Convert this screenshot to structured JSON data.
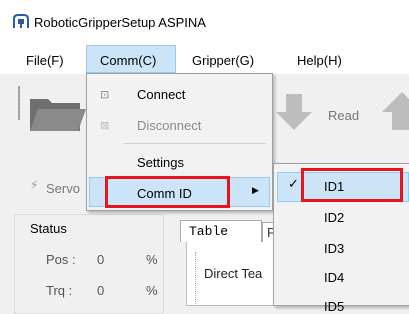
{
  "window": {
    "title": "RoboticGripperSetup ASPINA"
  },
  "menubar": {
    "items": [
      {
        "label": "File(F)"
      },
      {
        "label": "Comm(C)"
      },
      {
        "label": "Gripper(G)"
      },
      {
        "label": "Help(H)"
      }
    ]
  },
  "toolbar": {
    "read_label": "Read"
  },
  "servo": {
    "label": "Servo"
  },
  "status": {
    "title": "Status",
    "pos_label": "Pos :",
    "pos_value": "0",
    "pos_unit": "%",
    "trq_label": "Trq :",
    "trq_value": "0",
    "trq_unit": "%"
  },
  "tabs": {
    "active_label": "Table",
    "second_label": "P"
  },
  "panel": {
    "direct_teach_label": "Direct Tea"
  },
  "comm_menu": {
    "items": [
      {
        "label": "Connect",
        "icon": "connect-icon",
        "enabled": true
      },
      {
        "label": "Disconnect",
        "icon": "disconnect-icon",
        "enabled": false
      },
      {
        "label": "Settings",
        "enabled": true
      },
      {
        "label": "Comm ID",
        "enabled": true,
        "has_submenu": true
      }
    ]
  },
  "comm_id_submenu": {
    "checkmark": "✓",
    "items": [
      {
        "label": "ID1",
        "checked": true
      },
      {
        "label": "ID2",
        "checked": false
      },
      {
        "label": "ID3",
        "checked": false
      },
      {
        "label": "ID4",
        "checked": false
      },
      {
        "label": "ID5",
        "checked": false
      }
    ]
  },
  "colors": {
    "highlight": "#cce4f7",
    "highlight_border": "#99c9ef",
    "annotation_red": "#e8141b"
  }
}
